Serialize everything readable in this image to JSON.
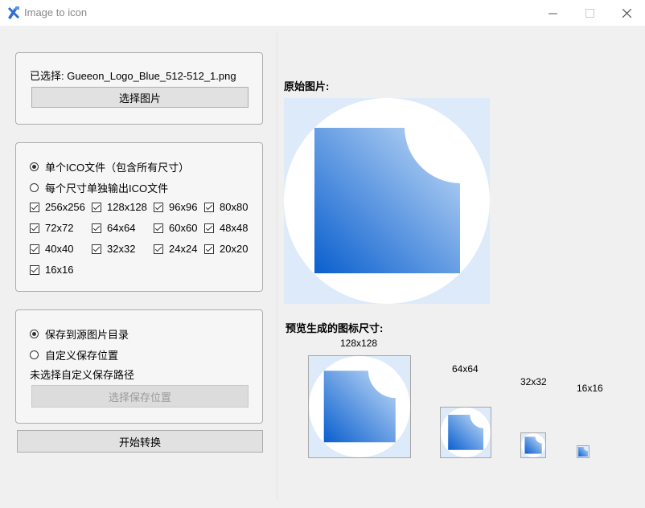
{
  "window": {
    "title": "Image to icon"
  },
  "source_section": {
    "selected_text": "已选择: Gueeon_Logo_Blue_512-512_1.png",
    "select_button": "选择图片"
  },
  "output_mode": {
    "options": [
      {
        "label": "单个ICO文件（包含所有尺寸）",
        "selected": true
      },
      {
        "label": "每个尺寸单独输出ICO文件",
        "selected": false
      }
    ],
    "sizes": [
      {
        "label": "256x256",
        "checked": true
      },
      {
        "label": "128x128",
        "checked": true
      },
      {
        "label": "96x96",
        "checked": true
      },
      {
        "label": "80x80",
        "checked": true
      },
      {
        "label": "72x72",
        "checked": true
      },
      {
        "label": "64x64",
        "checked": true
      },
      {
        "label": "60x60",
        "checked": true
      },
      {
        "label": "48x48",
        "checked": true
      },
      {
        "label": "40x40",
        "checked": true
      },
      {
        "label": "32x32",
        "checked": true
      },
      {
        "label": "24x24",
        "checked": true
      },
      {
        "label": "20x20",
        "checked": true
      },
      {
        "label": "16x16",
        "checked": true
      }
    ]
  },
  "save_section": {
    "options": [
      {
        "label": "保存到源图片目录",
        "selected": true
      },
      {
        "label": "自定义保存位置",
        "selected": false
      }
    ],
    "path_status": "未选择自定义保存路径",
    "choose_location_button": "选择保存位置"
  },
  "start_button": "开始转换",
  "preview": {
    "original_label": "原始图片:",
    "generated_label": "预览生成的图标尺寸:",
    "sizes": [
      "128x128",
      "64x64",
      "32x32",
      "16x16"
    ]
  },
  "colors": {
    "accent_dark": "#0a5fcf",
    "accent_light": "#c6def8",
    "preview_bg": "#ddeafa"
  }
}
